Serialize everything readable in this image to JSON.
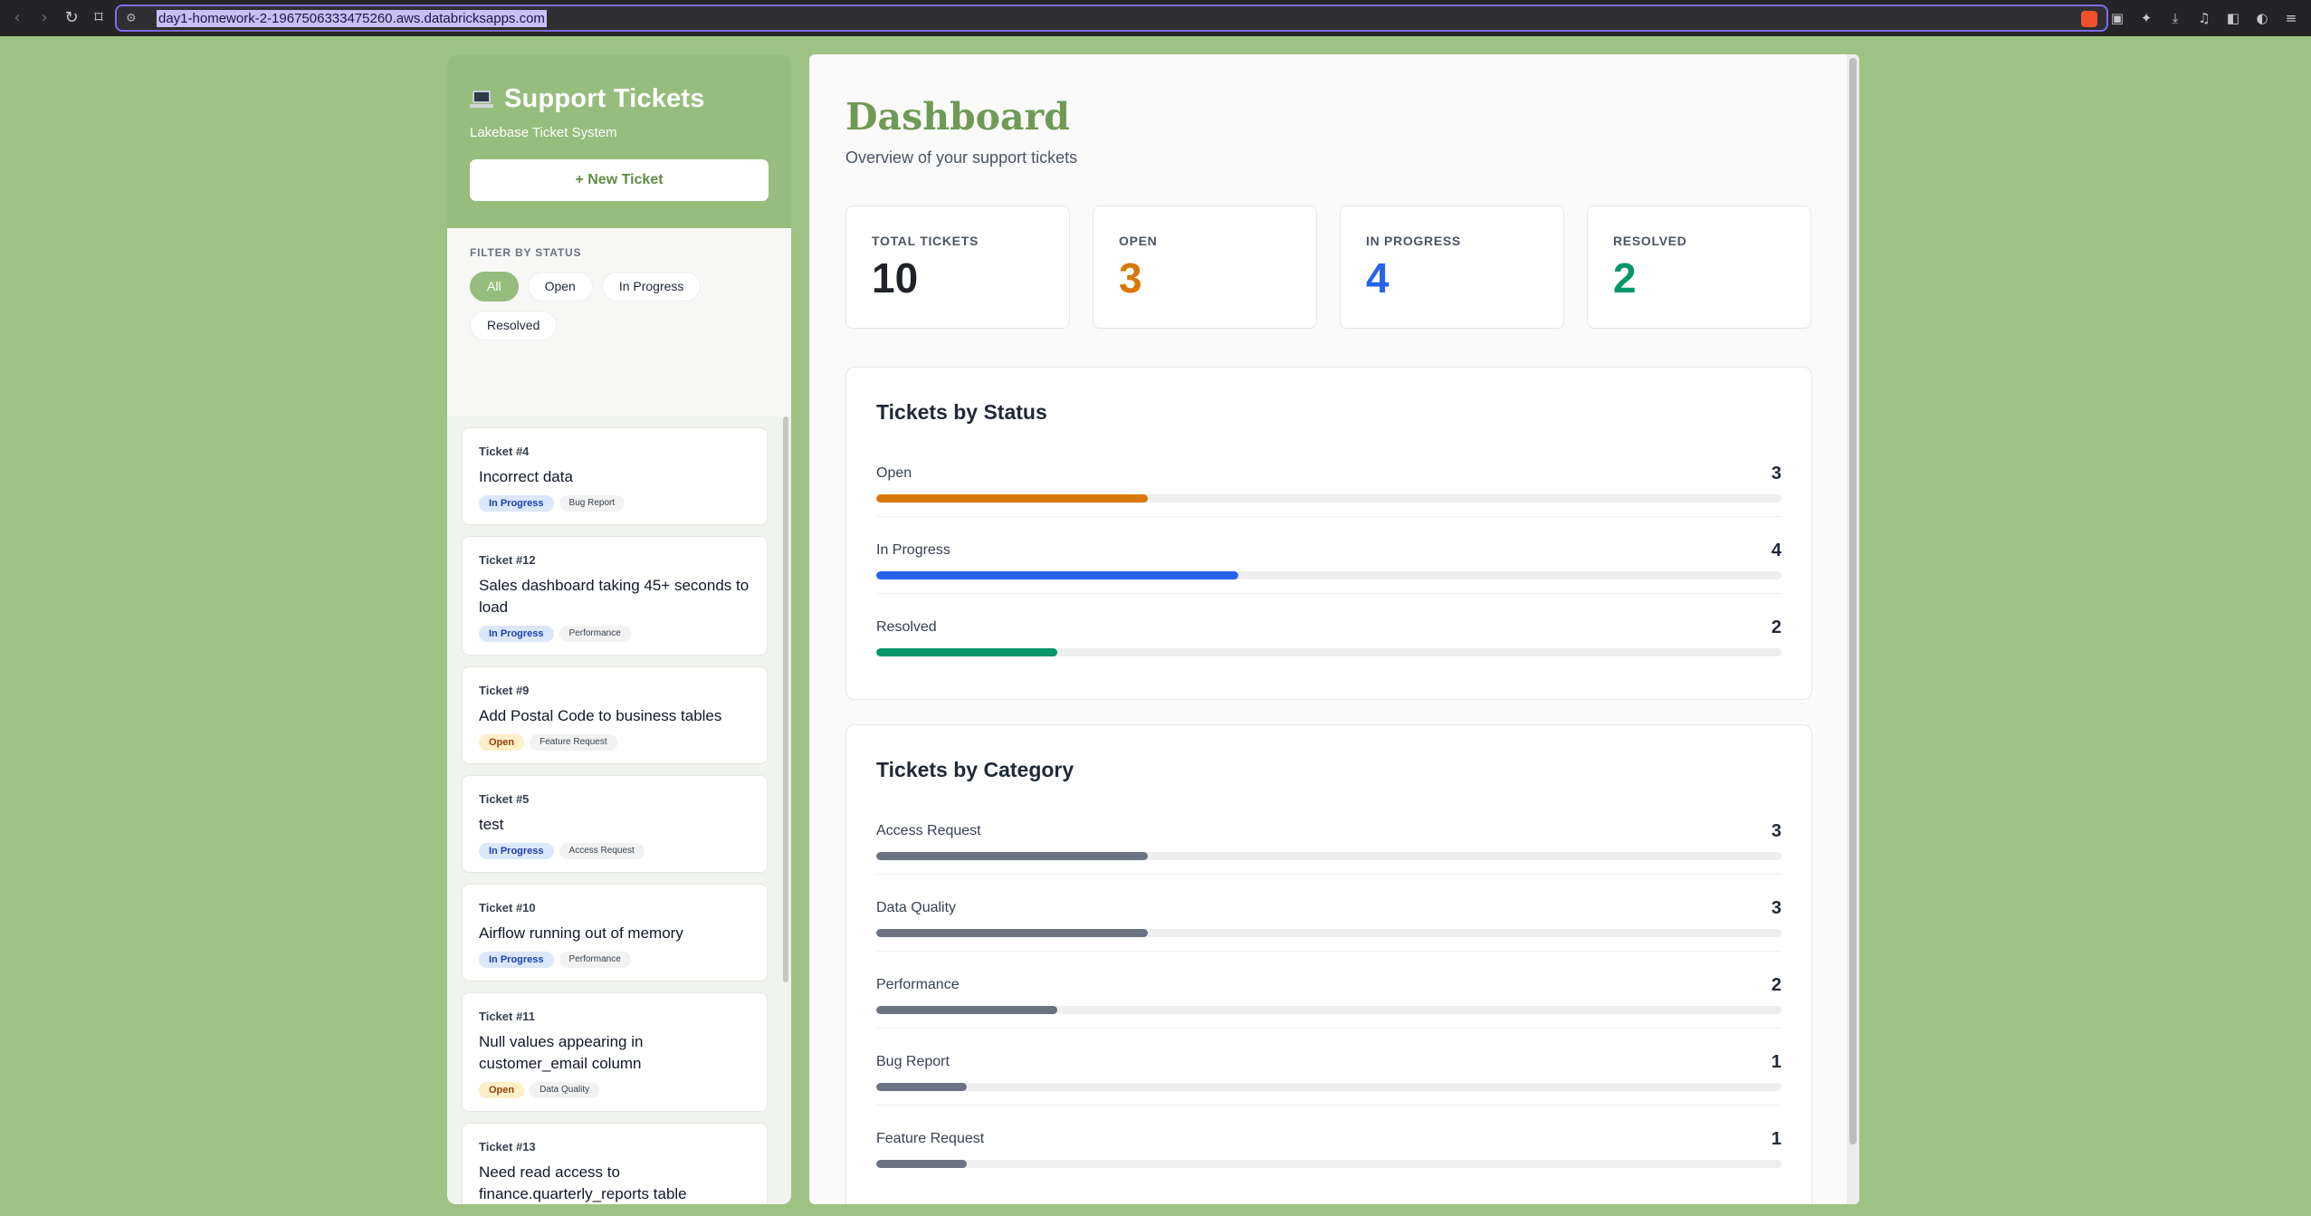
{
  "browser": {
    "url": "day1-homework-2-1967506333475260.aws.databricksapps.com"
  },
  "sidebar": {
    "title": "Support Tickets",
    "subtitle": "Lakebase Ticket System",
    "new_ticket_label": "+ New Ticket",
    "filter_label": "FILTER BY STATUS",
    "filters": [
      {
        "label": "All",
        "active": true
      },
      {
        "label": "Open",
        "active": false
      },
      {
        "label": "In Progress",
        "active": false
      },
      {
        "label": "Resolved",
        "active": false
      }
    ],
    "tickets": [
      {
        "id": "Ticket #4",
        "title": "Incorrect data",
        "status": "In Progress",
        "category": "Bug Report"
      },
      {
        "id": "Ticket #12",
        "title": "Sales dashboard taking 45+ seconds to load",
        "status": "In Progress",
        "category": "Performance"
      },
      {
        "id": "Ticket #9",
        "title": "Add Postal Code to business tables",
        "status": "Open",
        "category": "Feature Request"
      },
      {
        "id": "Ticket #5",
        "title": "test",
        "status": "In Progress",
        "category": "Access Request"
      },
      {
        "id": "Ticket #10",
        "title": "Airflow running out of memory",
        "status": "In Progress",
        "category": "Performance"
      },
      {
        "id": "Ticket #11",
        "title": "Null values appearing in customer_email column",
        "status": "Open",
        "category": "Data Quality"
      },
      {
        "id": "Ticket #13",
        "title": "Need read access to finance.quarterly_reports table",
        "status": "",
        "category": ""
      }
    ]
  },
  "main": {
    "title": "Dashboard",
    "subtitle": "Overview of your support tickets",
    "stats": [
      {
        "label": "TOTAL TICKETS",
        "value": "10",
        "color": "#1f2328"
      },
      {
        "label": "OPEN",
        "value": "3",
        "color": "#d97706"
      },
      {
        "label": "IN PROGRESS",
        "value": "4",
        "color": "#2563eb"
      },
      {
        "label": "RESOLVED",
        "value": "2",
        "color": "#059669"
      }
    ],
    "by_status": {
      "title": "Tickets by Status",
      "total": 10,
      "rows": [
        {
          "label": "Open",
          "count": 3,
          "color": "#d97706"
        },
        {
          "label": "In Progress",
          "count": 4,
          "color": "#2563eb"
        },
        {
          "label": "Resolved",
          "count": 2,
          "color": "#059669"
        }
      ]
    },
    "by_category": {
      "title": "Tickets by Category",
      "total": 10,
      "rows": [
        {
          "label": "Access Request",
          "count": 3,
          "color": "#6b7280"
        },
        {
          "label": "Data Quality",
          "count": 3,
          "color": "#6b7280"
        },
        {
          "label": "Performance",
          "count": 2,
          "color": "#6b7280"
        },
        {
          "label": "Bug Report",
          "count": 1,
          "color": "#6b7280"
        },
        {
          "label": "Feature Request",
          "count": 1,
          "color": "#6b7280"
        }
      ]
    }
  }
}
